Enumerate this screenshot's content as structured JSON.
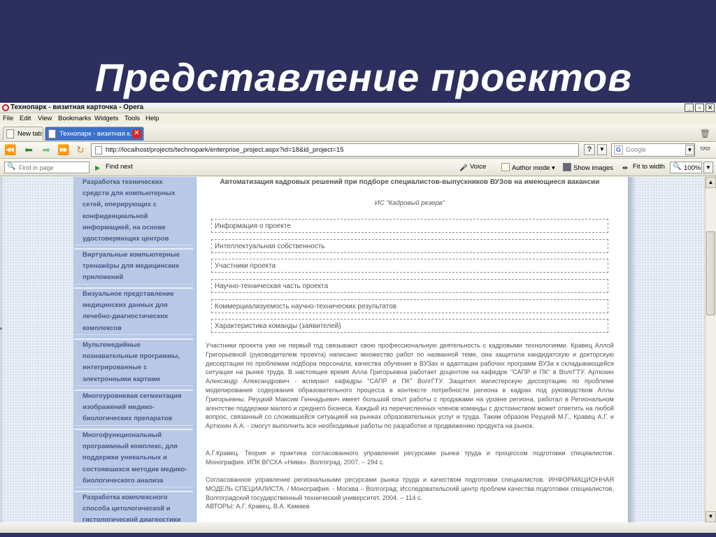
{
  "slide": {
    "title": "Представление проектов"
  },
  "browser": {
    "window_title": "Технопарк - визитная карточка - Opera",
    "window_buttons": [
      "_",
      "▫",
      "✕"
    ],
    "menu": [
      "File",
      "Edit",
      "View",
      "Bookmarks",
      "Widgets",
      "Tools",
      "Help"
    ],
    "tabs": [
      {
        "label": "New tab",
        "active": false
      },
      {
        "label": "Технопарк - визитная к...",
        "active": true
      }
    ],
    "url": "http://localhost/projects/technopark/enterprise_project.aspx?id=18&id_project=15",
    "search_engine": "Google",
    "find_placeholder": "Find in page",
    "find_next_label": "Find next",
    "voice_label": "Voice",
    "author_mode_label": "Author mode",
    "show_images_label": "Show images",
    "fit_to_width_label": "Fit to width",
    "zoom": "100%"
  },
  "sidebar": {
    "items": [
      "Разработка технических средств для компьютерных сетей, оперирующих с конфиденциальной информацией, на основе удостоверяющих центров",
      "Виртуальные компьютерные тренажёры для медицинских приложений",
      "Визуальное представление медицинских данных для лечебно-диагностических комплексов",
      "Мультемедийные познавательные программы, интегрированные с электронными картами",
      "Многоуровневая сегментация изображений медико-биологических препаратов",
      "Многофункциональный программный комплекс, для поддержки уникальных и состоявшихся методик медико-биологического анализа",
      "Разработка комплексного способа цитологической и гистологической диагностики"
    ]
  },
  "content": {
    "title": "Автоматизация кадровых решений при подборе специалистов-выпускников ВУЗов на имеющиеся вакансии",
    "subtitle": "ИС \"Кадровый резерв\"",
    "menu_items": [
      "Информация о проекте",
      "Интеллектуальная собственность",
      "Участники проекта",
      "Научно-техническая часть проекта",
      "Коммерциализуемость научно-технических результатов",
      "Характеристика команды (заявителей)"
    ],
    "paragraphs": [
      "Участники проекта уже не первый год связывают свою профессиональную деятельность с кадровыми технологиями. Кравец Аллой Григорьевной (руководителем проекта) написано множество работ по названной теме, она защитила кандидатскую и докторскую диссертации по проблемам подбора персонала, качества обучения в ВУЗах и адаптации рабочих программ ВУЗа к складывающейся ситуации на рынке труда. В настоящее время Алла Григорьевна работает доцентом на кафедре \"САПР и ПК\" в ВолгГТУ. Артюхин Александр Александрович - аспирант кафедры \"САПР и ПК\" ВолгГТУ. Защитил магистерскую диссертацию по проблеме моделирования содержания образовательного процесса в контексте потребности региона в кадрах под руководством Аллы Григорьевны. Реуцкий Максим Геннадьевич имеет большой опыт работы с продажами на уровне региона, работал в Региональном агентстве поддержки малого и среднего бизнеса. Каждый из перечисленных членов команды с достоинством может ответить на любой вопрос, связанный со сложившейся ситуацией на рынках образовательных услуг и труда. Таким образом Реуцкий М.Г., Кравец А.Г. и Артюхин А.А. - смогут выполнить все необходимые работы по разработке и продвижению продукта на рынок.",
      "А.Г.Кравец. Теория и практика согласованного управления ресурсами рынка труда и процессом подготовки специалистов. Монография. ИПК ВГСХА «Нива». Волгоград. 2007. – 294 с.",
      "Согласованное управление региональными ресурсами рынка труда и качеством подготовки специалистов. ИНФОРМАЦИОННАЯ МОДЕЛЬ СПЕЦИАЛИСТА. / Монография. - Москва – Волгоград: Исследовательский центр проблем качества подготовки специалистов, Волгоградский государственный технический университет, 2004. – 114 с.",
      "АВТОРЫ: А.Г. Кравец, В.А. Камаев"
    ]
  },
  "colors": {
    "slide_bg": "#2d2f5e",
    "sidebar_bg": "#b8c8e6",
    "sidebar_text": "#475a82",
    "active_tab": "#3c73c9"
  }
}
